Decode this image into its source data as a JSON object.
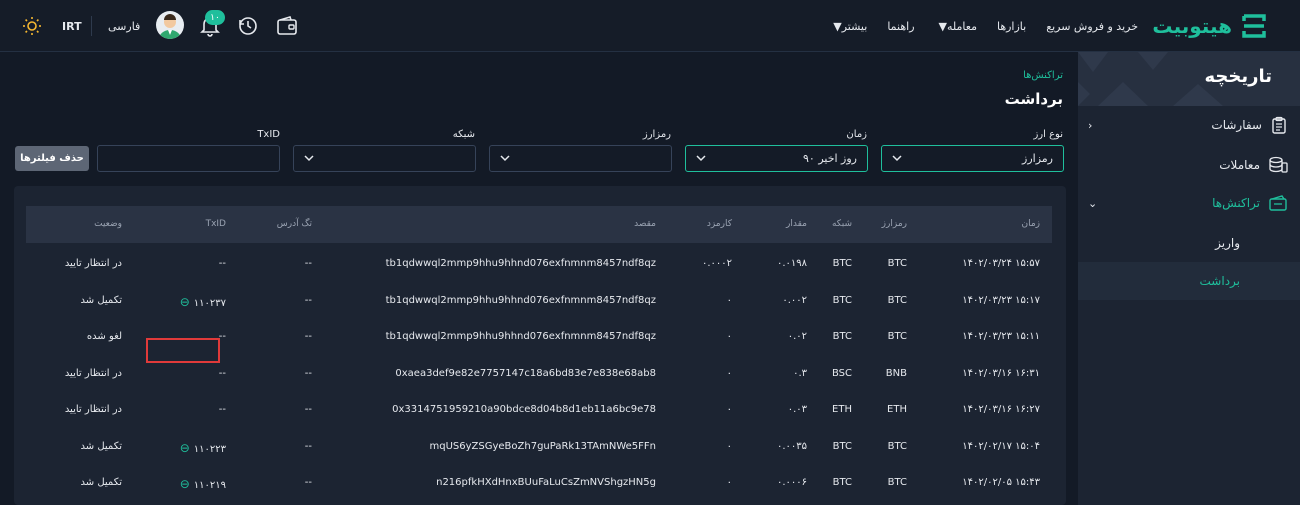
{
  "topbar": {
    "logo_text": "هیتوبیت",
    "nav": [
      {
        "label": "خرید و فروش سریع",
        "caret": false
      },
      {
        "label": "بازارها",
        "caret": false
      },
      {
        "label": "معامله",
        "caret": true
      },
      {
        "label": "راهنما",
        "caret": false
      },
      {
        "label": "بیشتر",
        "caret": true
      }
    ],
    "notification_count": "۱۰",
    "language": "فارسی",
    "currency": "IRT"
  },
  "sidebar": {
    "title": "تاریخچه",
    "items": [
      {
        "label": "سفارشات",
        "icon": "clipboard-icon"
      },
      {
        "label": "معاملات",
        "icon": "coins-icon"
      },
      {
        "label": "تراکنش‌ها",
        "icon": "transactions-icon"
      }
    ],
    "subitems": [
      {
        "label": "واریز"
      },
      {
        "label": "برداشت"
      }
    ]
  },
  "page": {
    "breadcrumb": "تراکنش‌ها",
    "title": "برداشت"
  },
  "filters": {
    "currency_type_label": "نوع ارز",
    "currency_type_value": "رمزارز",
    "time_label": "زمان",
    "time_value": "۹۰ روز اخیر",
    "crypto_label": "رمزارز",
    "network_label": "شبکه",
    "txid_label": "TxID",
    "clear_label": "حذف فیلترها"
  },
  "table": {
    "headers": {
      "time": "زمان",
      "crypto": "رمزارز",
      "network": "شبکه",
      "amount": "مقدار",
      "fee": "کارمزد",
      "destination": "مقصد",
      "tag": "تگ آدرس",
      "txid": "TxID",
      "status": "وضعیت"
    },
    "rows": [
      {
        "time": "۱۴۰۲/۰۳/۲۴ ۱۵:۵۷",
        "crypto": "BTC",
        "network": "BTC",
        "amount": "۰.۰۱۹۸",
        "fee": "۰.۰۰۰۲",
        "destination": "tb1qdwwql2mmp9hhu9hhnd076exfnmnm8457ndf8qz",
        "tag": "--",
        "txid": "--",
        "status": "در انتظار تایید"
      },
      {
        "time": "۱۴۰۲/۰۳/۲۳ ۱۵:۱۷",
        "crypto": "BTC",
        "network": "BTC",
        "amount": "۰.۰۰۲",
        "fee": "۰",
        "destination": "tb1qdwwql2mmp9hhu9hhnd076exfnmnm8457ndf8qz",
        "tag": "--",
        "txid": "۱۱۰۲۳۷",
        "status": "تکمیل شد"
      },
      {
        "time": "۱۴۰۲/۰۳/۲۳ ۱۵:۱۱",
        "crypto": "BTC",
        "network": "BTC",
        "amount": "۰.۰۲",
        "fee": "۰",
        "destination": "tb1qdwwql2mmp9hhu9hhnd076exfnmnm8457ndf8qz",
        "tag": "--",
        "txid": "--",
        "status": "لغو شده"
      },
      {
        "time": "۱۴۰۲/۰۳/۱۶ ۱۶:۳۱",
        "crypto": "BNB",
        "network": "BSC",
        "amount": "۰.۳",
        "fee": "۰",
        "destination": "0xaea3def9e82e7757147c18a6bd83e7e838e68ab8",
        "tag": "--",
        "txid": "--",
        "status": "در انتظار تایید"
      },
      {
        "time": "۱۴۰۲/۰۳/۱۶ ۱۶:۲۷",
        "crypto": "ETH",
        "network": "ETH",
        "amount": "۰.۰۳",
        "fee": "۰",
        "destination": "0x3314751959210a90bdce8d04b8d1eb11a6bc9e78",
        "tag": "--",
        "txid": "--",
        "status": "در انتظار تایید"
      },
      {
        "time": "۱۴۰۲/۰۲/۱۷ ۱۵:۰۴",
        "crypto": "BTC",
        "network": "BTC",
        "amount": "۰.۰۰۳۵",
        "fee": "۰",
        "destination": "mqUS6yZSGyeBoZh7guPaRk13TAmNWe5FFn",
        "tag": "--",
        "txid": "۱۱۰۲۲۳",
        "status": "تکمیل شد"
      },
      {
        "time": "۱۴۰۲/۰۲/۰۵ ۱۵:۴۳",
        "crypto": "BTC",
        "network": "BTC",
        "amount": "۰.۰۰۰۶",
        "fee": "۰",
        "destination": "n216pfkHXdHnxBUuFaLuCsZmNVShgzHN5g",
        "tag": "--",
        "txid": "۱۱۰۲۱۹",
        "status": "تکمیل شد"
      }
    ]
  },
  "colors": {
    "accent": "#1fbf9c",
    "highlight_box": "#e03a3a",
    "background": "#131a26"
  }
}
